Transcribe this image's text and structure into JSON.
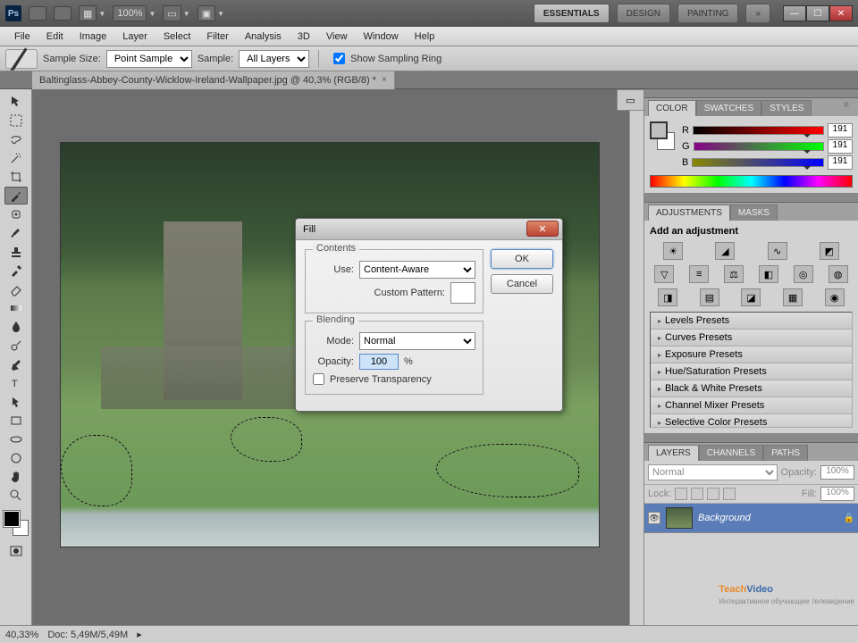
{
  "titlebar": {
    "app_icon": "Ps",
    "zoom_display": "100%",
    "workspaces": [
      "ESSENTIALS",
      "DESIGN",
      "PAINTING"
    ],
    "expand_icon": "»"
  },
  "menubar": [
    "File",
    "Edit",
    "Image",
    "Layer",
    "Select",
    "Filter",
    "Analysis",
    "3D",
    "View",
    "Window",
    "Help"
  ],
  "optionsbar": {
    "sample_size_label": "Sample Size:",
    "sample_size_value": "Point Sample",
    "sample_label": "Sample:",
    "sample_value": "All Layers",
    "show_ring_label": "Show Sampling Ring"
  },
  "doc_tab": {
    "title": "Baltinglass-Abbey-County-Wicklow-Ireland-Wallpaper.jpg @ 40,3% (RGB/8) *"
  },
  "tools": [
    "move",
    "marquee",
    "lasso",
    "wand",
    "crop",
    "eyedropper",
    "healing",
    "brush",
    "stamp",
    "history-brush",
    "eraser",
    "gradient",
    "blur",
    "dodge",
    "pen",
    "type",
    "path-select",
    "shape",
    "3d-rotate",
    "3d-orbit",
    "hand",
    "zoom"
  ],
  "color_panel": {
    "tabs": [
      "COLOR",
      "SWATCHES",
      "STYLES"
    ],
    "channels": [
      {
        "label": "R",
        "value": "191"
      },
      {
        "label": "G",
        "value": "191"
      },
      {
        "label": "B",
        "value": "191"
      }
    ]
  },
  "adjustments": {
    "tabs": [
      "ADJUSTMENTS",
      "MASKS"
    ],
    "hint": "Add an adjustment",
    "presets": [
      "Levels Presets",
      "Curves Presets",
      "Exposure Presets",
      "Hue/Saturation Presets",
      "Black & White Presets",
      "Channel Mixer Presets",
      "Selective Color Presets"
    ]
  },
  "layers_panel": {
    "tabs": [
      "LAYERS",
      "CHANNELS",
      "PATHS"
    ],
    "blend_mode": "Normal",
    "opacity_label": "Opacity:",
    "opacity_value": "100%",
    "lock_label": "Lock:",
    "fill_label": "Fill:",
    "fill_value": "100%",
    "layer_name": "Background"
  },
  "dialog": {
    "title": "Fill",
    "contents_legend": "Contents",
    "use_label": "Use:",
    "use_value": "Content-Aware",
    "custom_pattern_label": "Custom Pattern:",
    "blending_legend": "Blending",
    "mode_label": "Mode:",
    "mode_value": "Normal",
    "opacity_label": "Opacity:",
    "opacity_value": "100",
    "percent": "%",
    "preserve_label": "Preserve Transparency",
    "ok": "OK",
    "cancel": "Cancel"
  },
  "status": {
    "zoom": "40,33%",
    "doc_info": "Doc: 5,49M/5,49M"
  },
  "watermark": {
    "t": "Teach",
    "v": "Video",
    "sub": "Интерактивное обучающее телевидение"
  }
}
